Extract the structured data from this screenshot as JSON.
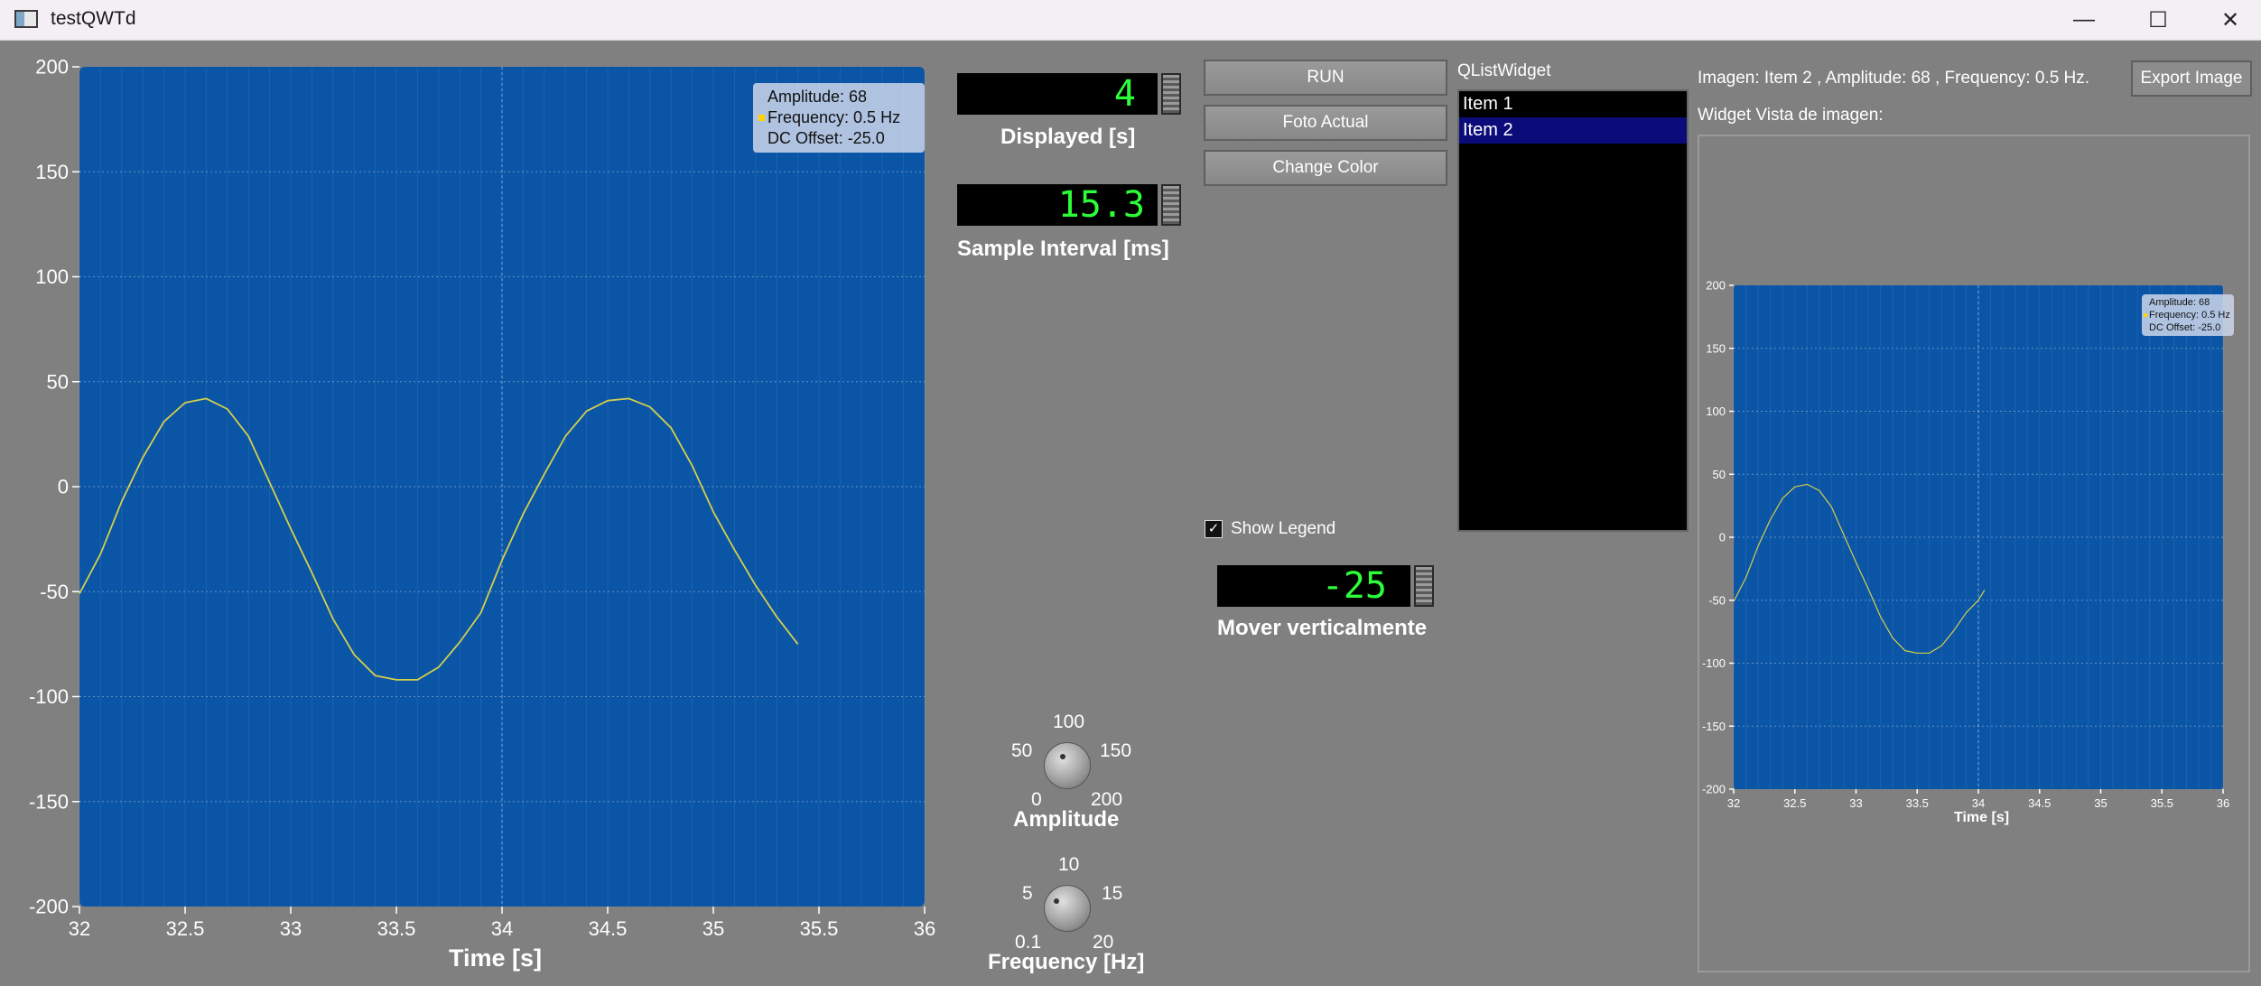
{
  "window": {
    "title": "testQWTd",
    "minimize_glyph": "—",
    "maximize_glyph": "☐",
    "close_glyph": "✕"
  },
  "colors": {
    "background": "#808080",
    "plot_canvas": "#0b55a6",
    "curve": "#d4d04a",
    "lcd_digits": "#2cff3a",
    "selection": "#0b0b7a"
  },
  "main_plot": {
    "legend": {
      "line1": "Amplitude: 68",
      "line2": "Frequency: 0.5 Hz",
      "line3": "DC Offset: -25.0"
    },
    "x_title": "Time [s]"
  },
  "preview_plot": {
    "legend": {
      "line1": "Amplitude: 68",
      "line2": "Frequency: 0.5 Hz",
      "line3": "DC Offset: -25.0"
    },
    "x_title": "Time [s]"
  },
  "chart_data": [
    {
      "type": "line",
      "title": "",
      "xlabel": "Time [s]",
      "ylabel": "",
      "xlim": [
        32,
        36
      ],
      "ylim": [
        -200,
        200
      ],
      "x_ticks": [
        "32",
        "32.5",
        "33",
        "33.5",
        "34",
        "34.5",
        "35",
        "35.5",
        "36"
      ],
      "y_ticks": [
        "200",
        "150",
        "100",
        "50",
        "0",
        "-50",
        "-100",
        "-150",
        "-200"
      ],
      "grid": true,
      "legend_position": "top-right",
      "series": [
        {
          "x": [
            32.0,
            32.1,
            32.2,
            32.3,
            32.4,
            32.5,
            32.6,
            32.7,
            32.8,
            32.9,
            33.0,
            33.1,
            33.2,
            33.3,
            33.4,
            33.5,
            33.6,
            33.7,
            33.8,
            33.9,
            34.0,
            34.1,
            34.2,
            34.3,
            34.4,
            34.5,
            34.6,
            34.7,
            34.8,
            34.9,
            35.0,
            35.1,
            35.2,
            35.3,
            35.4
          ],
          "y": [
            -51,
            -32,
            -7,
            14,
            31,
            40,
            42,
            37,
            24,
            2,
            -20,
            -41,
            -63,
            -80,
            -90,
            -92,
            -92,
            -86,
            -74,
            -60,
            -35,
            -13,
            6,
            24,
            36,
            41,
            42,
            38,
            28,
            10,
            -12,
            -30,
            -47,
            -62,
            -75
          ]
        }
      ]
    },
    {
      "type": "line",
      "title": "",
      "xlabel": "Time [s]",
      "ylabel": "",
      "xlim": [
        32,
        36
      ],
      "ylim": [
        -200,
        200
      ],
      "x_ticks": [
        "32",
        "32.5",
        "33",
        "33.5",
        "34",
        "34.5",
        "35",
        "35.5",
        "36"
      ],
      "y_ticks": [
        "200",
        "150",
        "100",
        "50",
        "0",
        "-50",
        "-100",
        "-150",
        "-200"
      ],
      "grid": true,
      "legend_position": "top-right",
      "series": [
        {
          "x": [
            32.0,
            32.1,
            32.2,
            32.3,
            32.4,
            32.5,
            32.6,
            32.7,
            32.8,
            32.9,
            33.0,
            33.1,
            33.2,
            33.3,
            33.4,
            33.5,
            33.6,
            33.7,
            33.8,
            33.9,
            34.0,
            34.05
          ],
          "y": [
            -51,
            -32,
            -7,
            14,
            31,
            40,
            42,
            37,
            24,
            2,
            -20,
            -41,
            -63,
            -80,
            -90,
            -92,
            -92,
            -86,
            -74,
            -60,
            -50,
            -42
          ]
        }
      ]
    }
  ],
  "displayed": {
    "value": "4",
    "label": "Displayed [s]"
  },
  "sample_interval": {
    "value": "15.3",
    "label": "Sample Interval [ms]"
  },
  "buttons": {
    "run": "RUN",
    "foto": "Foto Actual",
    "color": "Change Color",
    "export": "Export Image"
  },
  "list_widget": {
    "title": "QListWidget",
    "items": [
      "Item 1",
      "Item 2"
    ],
    "selected_index": 1
  },
  "info_text": "Imagen: Item 2 ,  Amplitude: 68 ,  Frequency: 0.5 Hz.",
  "preview_label": "Widget Vista de imagen:",
  "show_legend": {
    "label": "Show Legend",
    "checked": true,
    "check_glyph": "✓"
  },
  "vertical": {
    "value": "-25",
    "label": "Mover verticalmente"
  },
  "amplitude_knob": {
    "label": "Amplitude",
    "scale": {
      "s0": "0",
      "s50": "50",
      "s100": "100",
      "s150": "150",
      "s200": "200"
    }
  },
  "frequency_knob": {
    "label": "Frequency [Hz]",
    "scale": {
      "s01": "0.1",
      "s5": "5",
      "s10": "10",
      "s15": "15",
      "s20": "20"
    }
  }
}
